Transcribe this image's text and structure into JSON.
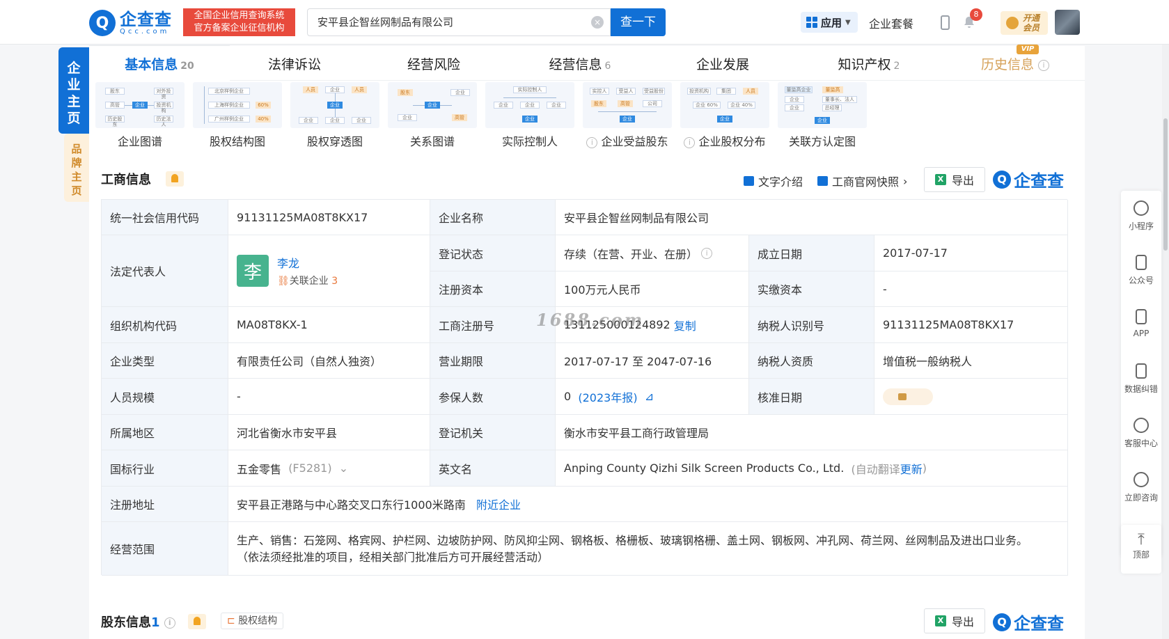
{
  "header": {
    "logo_cn": "企查查",
    "logo_en": "Qcc.com",
    "tagline_1": "全国企业信用查询系统",
    "tagline_2": "官方备案企业征信机构",
    "search_value": "安平县企智丝网制品有限公司",
    "search_button": "查一下",
    "apps_label": "应用",
    "package_label": "企业套餐",
    "notification_count": "8",
    "vip_line1": "开通",
    "vip_line2": "会员"
  },
  "side_tabs": {
    "main": "企业主页",
    "brand": "品牌主页"
  },
  "tabs": [
    {
      "label": "基本信息",
      "count": "20"
    },
    {
      "label": "法律诉讼",
      "count": ""
    },
    {
      "label": "经营风险",
      "count": ""
    },
    {
      "label": "经营信息",
      "count": "6"
    },
    {
      "label": "企业发展",
      "count": ""
    },
    {
      "label": "知识产权",
      "count": "2"
    },
    {
      "label": "历史信息",
      "count": ""
    }
  ],
  "vip_badge": "VIP",
  "thumbnails": [
    {
      "label": "企业图谱"
    },
    {
      "label": "股权结构图"
    },
    {
      "label": "股权穿透图"
    },
    {
      "label": "关系图谱"
    },
    {
      "label": "实际控制人"
    },
    {
      "label": "企业受益股东"
    },
    {
      "label": "企业股权分布"
    },
    {
      "label": "关联方认定图"
    }
  ],
  "business": {
    "title": "工商信息",
    "text_intro": "文字介绍",
    "snapshot": "工商官网快照",
    "export": "导出",
    "brand": "企查查"
  },
  "table": {
    "credit_code_label": "统一社会信用代码",
    "credit_code": "91131125MA08T8KX17",
    "company_name_label": "企业名称",
    "company_name": "安平县企智丝网制品有限公司",
    "legal_rep_label": "法定代表人",
    "legal_rep_avatar": "李",
    "legal_rep": "李龙",
    "related_label": "关联企业",
    "related_count": "3",
    "status_label": "登记状态",
    "status": "存续（在营、开业、在册）",
    "established_label": "成立日期",
    "established": "2017-07-17",
    "reg_capital_label": "注册资本",
    "reg_capital": "100万元人民币",
    "paid_capital_label": "实缴资本",
    "paid_capital": "-",
    "org_code_label": "组织机构代码",
    "org_code": "MA08T8KX-1",
    "reg_no_label": "工商注册号",
    "reg_no": "131125000124892",
    "copy_label": "复制",
    "taxpayer_id_label": "纳税人识别号",
    "taxpayer_id": "91131125MA08T8KX17",
    "type_label": "企业类型",
    "type": "有限责任公司（自然人独资）",
    "term_label": "营业期限",
    "term": "2017-07-17 至 2047-07-16",
    "tax_quality_label": "纳税人资质",
    "tax_quality": "增值税一般纳税人",
    "staff_label": "人员规模",
    "staff": "-",
    "insured_label": "参保人数",
    "insured": "0",
    "insured_year": "(2023年报)",
    "approval_label": "核准日期",
    "region_label": "所属地区",
    "region": "河北省衡水市安平县",
    "authority_label": "登记机关",
    "authority": "衡水市安平县工商行政管理局",
    "industry_label": "国标行业",
    "industry": "五金零售",
    "industry_code": "(F5281)",
    "english_label": "英文名",
    "english": "Anping County Qizhi Silk Screen Products Co., Ltd.",
    "auto_translate": "(自动翻译",
    "update": "更新",
    "close_paren": ")",
    "address_label": "注册地址",
    "address": "安平县正港路与中心路交叉口东行1000米路南",
    "nearby": "附近企业",
    "scope_label": "经营范围",
    "scope_line1": "生产、销售：石笼网、格宾网、护栏网、边坡防护网、防风抑尘网、钢格板、格栅板、玻璃钢格栅、盖土网、钢板网、冲孔网、荷兰网、丝网制品及进出口业务。",
    "scope_line2": "（依法须经批准的项目，经相关部门批准后方可开展经营活动）"
  },
  "watermark": "1688.com",
  "rail": [
    {
      "label": "小程序"
    },
    {
      "label": "公众号"
    },
    {
      "label": "APP"
    },
    {
      "label": "数据纠错"
    },
    {
      "label": "客服中心"
    },
    {
      "label": "立即咨询"
    },
    {
      "label": "顶部"
    }
  ],
  "shareholders": {
    "title": "股东信息",
    "count": "1",
    "structure": "股权结构",
    "export": "导出",
    "brand": "企查查"
  },
  "colors": {
    "brand_blue": "#1170d6",
    "label_bg": "#f2f6fb",
    "accent_orange": "#e8773a"
  }
}
